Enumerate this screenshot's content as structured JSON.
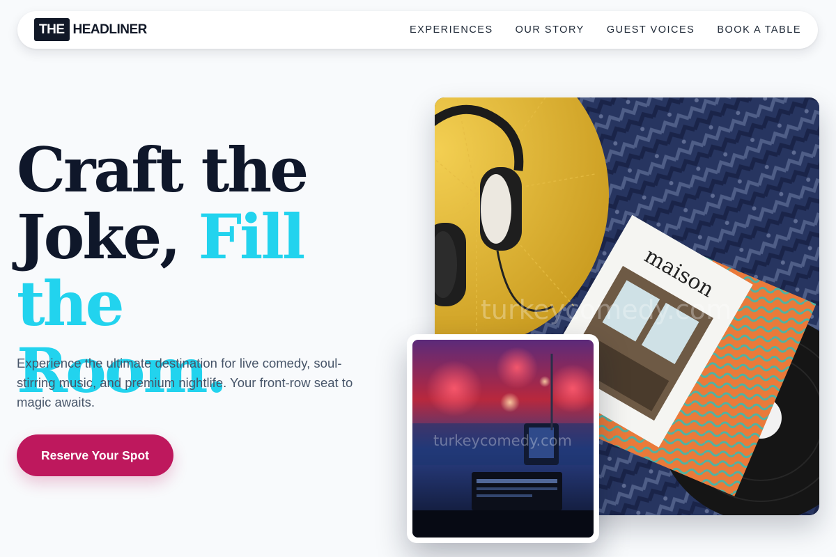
{
  "brand": {
    "badge": "THE",
    "name": "HEADLINER"
  },
  "nav": {
    "links": [
      "EXPERIENCES",
      "OUR STORY",
      "GUEST VOICES",
      "BOOK A TABLE"
    ]
  },
  "hero": {
    "headline_line1": "Craft the",
    "headline_line2": "Joke, ",
    "headline_accent_line2": "Fill the",
    "headline_accent_line3": "Room.",
    "description": "Experience the ultimate destination for live comedy, soul-stirring music, and premium nightlife. Your front-row seat to magic awaits.",
    "cta_label": "Reserve Your Spot"
  },
  "images": {
    "hero_magazine": "maison",
    "watermark": "turkeycomedy.com"
  },
  "colors": {
    "accent": "#22d3ee",
    "cta": "#be185d",
    "heading": "#0f172a",
    "text": "#475569",
    "background": "#f8fafc"
  }
}
